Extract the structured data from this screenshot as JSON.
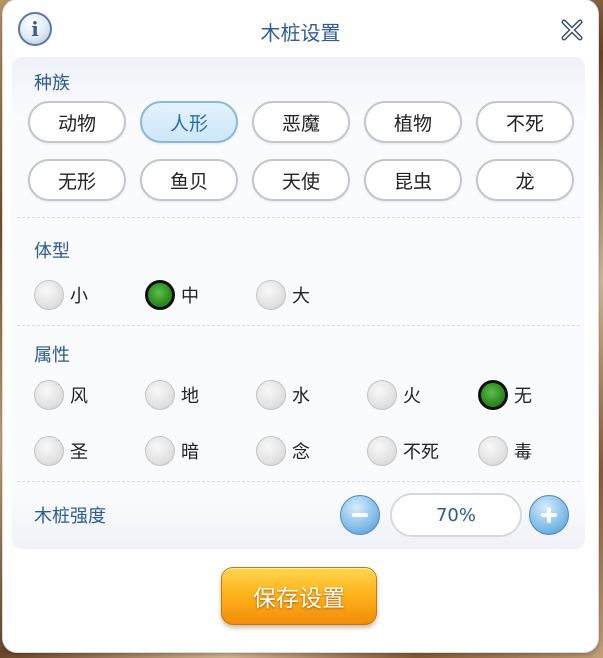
{
  "dialog": {
    "title": "木桩设置",
    "info_icon": "info-icon",
    "close_icon": "close-x-icon"
  },
  "race": {
    "label": "种族",
    "options": [
      "动物",
      "人形",
      "恶魔",
      "植物",
      "不死",
      "无形",
      "鱼贝",
      "天使",
      "昆虫",
      "龙"
    ],
    "selected": "人形"
  },
  "size": {
    "label": "体型",
    "options": [
      "小",
      "中",
      "大"
    ],
    "selected": "中"
  },
  "element": {
    "label": "属性",
    "options": [
      "风",
      "地",
      "水",
      "火",
      "无",
      "圣",
      "暗",
      "念",
      "不死",
      "毒"
    ],
    "selected": "无"
  },
  "strength": {
    "label": "木桩强度",
    "value": "70%",
    "decrease_icon": "minus-icon",
    "increase_icon": "plus-icon"
  },
  "save": {
    "label": "保存设置"
  },
  "colors": {
    "accent_blue": "#2d5a95",
    "selected_green": "#2f8f22",
    "save_orange": "#ffb51d"
  }
}
